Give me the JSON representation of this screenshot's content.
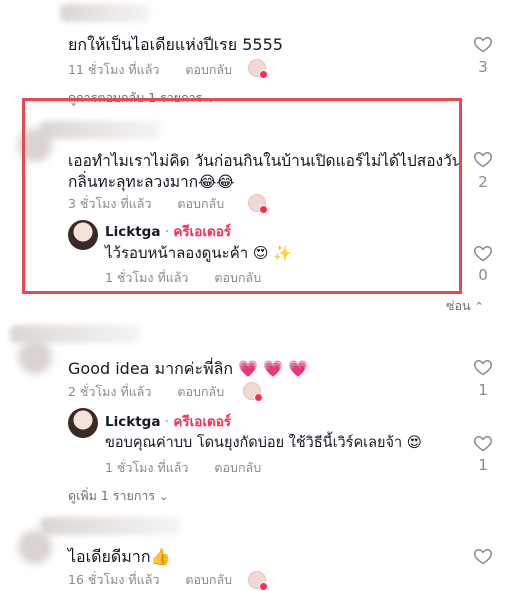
{
  "comments": [
    {
      "text": "ยกให้เป็นไอเดียแห่งปีเรย 5555",
      "time": "11 ชั่วโมง ที่แล้ว",
      "reply": "ตอบกลับ",
      "likes": "3",
      "view_replies": "ดูการตอบกลับ 1 รายการ"
    },
    {
      "text_line1": "เออทำไมเราไม่คิด วันก่อนกินในบ้านเปิดแอร์ไม่ได้ไปสองวัน",
      "text_line2": "กลิ่นทะลุทะลวงมาก😂😂",
      "time": "3 ชั่วโมง ที่แล้ว",
      "reply": "ตอบกลับ",
      "likes": "2",
      "creator_reply": {
        "username": "Licktga",
        "separator": " · ",
        "badge": "ครีเอเตอร์",
        "text": "ไว้รอบหน้าลองดูนะค้า 😍 ✨",
        "time": "1 ชั่วโมง ที่แล้ว",
        "reply": "ตอบกลับ",
        "likes": "0"
      },
      "hide": "ซ่อน"
    },
    {
      "text": "Good idea มากค่ะพี่ลิก 💗 💗 💗",
      "time": "2 ชั่วโมง ที่แล้ว",
      "reply": "ตอบกลับ",
      "likes": "1",
      "creator_reply": {
        "username": "Licktga",
        "separator": " · ",
        "badge": "ครีเอเตอร์",
        "text": "ขอบคุณค่าบบ โดนยุงกัดบ่อย ใช้วิธีนี้เวิร์คเลยจ้า 😍",
        "time": "1 ชั่วโมง ที่แล้ว",
        "reply": "ตอบกลับ",
        "likes": "1"
      },
      "view_more": "ดูเพิ่ม 1 รายการ"
    },
    {
      "text": "ไอเดียดีมาก👍",
      "time": "16 ชั่วโมง ที่แล้ว",
      "reply": "ตอบกลับ"
    }
  ],
  "icons": {
    "like": "heart-outline-icon",
    "expand": "chevron-down-icon",
    "collapse": "chevron-up-icon"
  },
  "colors": {
    "accent": "#fe2c55",
    "highlight": "#e44a4f",
    "meta": "#8a8b91"
  }
}
